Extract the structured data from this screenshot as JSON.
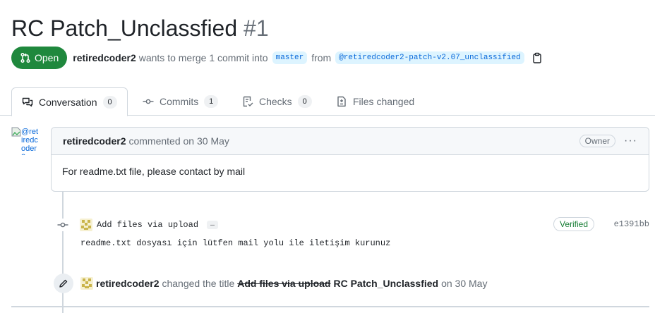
{
  "pr": {
    "title": "RC Patch_Unclassfied",
    "number": "#1",
    "state": "Open",
    "author": "retiredcoder2",
    "merge_text": "wants to merge 1 commit into",
    "base_branch": "master",
    "from_text": "from",
    "head_branch": "@retiredcoder2-patch-v2.07_unclassified",
    "icons": {
      "state": "git-pull-request-icon",
      "copy": "copy-icon"
    }
  },
  "tabs": [
    {
      "label": "Conversation",
      "count": "0",
      "icon": "comment-discussion-icon"
    },
    {
      "label": "Commits",
      "count": "1",
      "icon": "git-commit-icon"
    },
    {
      "label": "Checks",
      "count": "0",
      "icon": "checklist-icon"
    },
    {
      "label": "Files changed",
      "count": "",
      "icon": "file-diff-icon"
    }
  ],
  "comment": {
    "avatar_alt": "@retiredcoder2",
    "author": "retiredcoder2",
    "action": "commented on 30 May",
    "role": "Owner",
    "menu": "···",
    "body": "For readme.txt file, please contact by mail"
  },
  "commit": {
    "message": "Add files via upload",
    "ellipsis": "…",
    "verified": "Verified",
    "sha": "e1391bb",
    "description": "readme.txt dosyası için lütfen mail yolu ile iletişim kurunuz"
  },
  "rename_event": {
    "author": "retiredcoder2",
    "action": "changed the title",
    "old_title": "Add files via upload",
    "new_title": "RC Patch_Unclassfied",
    "date": "on 30 May"
  },
  "colors": {
    "open_green": "#1f883d",
    "link_blue": "#0969da",
    "branch_bg": "#ddf4ff",
    "verified_green": "#1a7f37",
    "border": "#d0d7de",
    "muted": "#656d76"
  }
}
